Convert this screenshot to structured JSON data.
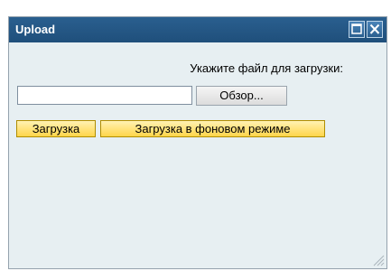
{
  "window": {
    "title": "Upload"
  },
  "form": {
    "prompt": "Укажите файл для загрузки:",
    "file_value": "",
    "browse_label": "Обзор..."
  },
  "actions": {
    "upload_label": "Загрузка",
    "background_upload_label": "Загрузка в фоновом режиме"
  },
  "icons": [
    "maximize-icon",
    "close-icon",
    "resize-grip-icon"
  ]
}
